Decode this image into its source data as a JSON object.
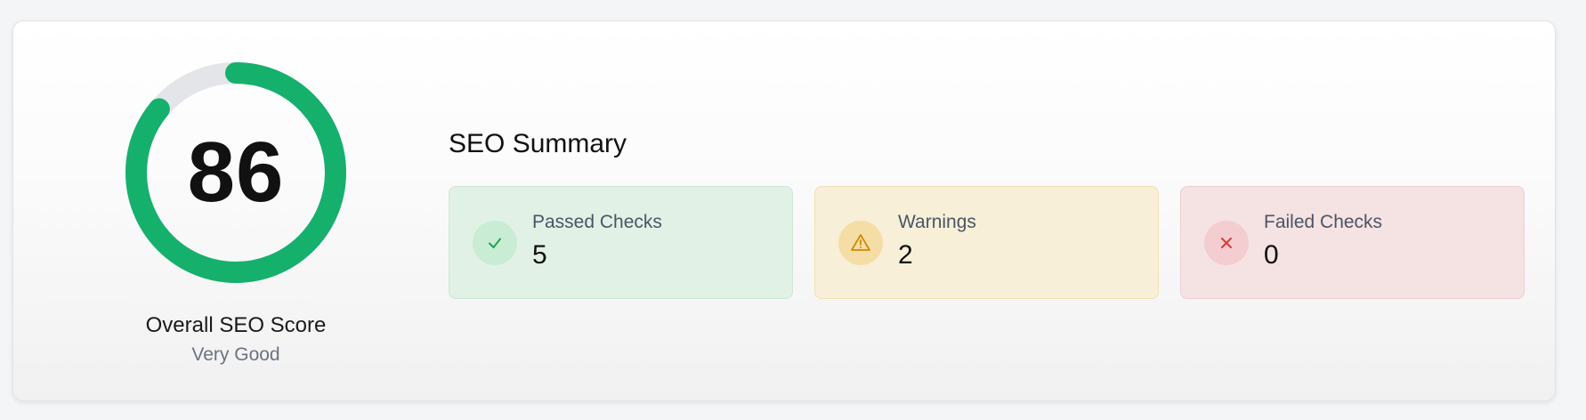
{
  "score": {
    "value": "86",
    "percent": 86,
    "label": "Overall SEO Score",
    "rating": "Very Good",
    "ring_color": "#16b06d",
    "track_color": "#e4e5e9"
  },
  "summary": {
    "title": "SEO Summary",
    "stats": [
      {
        "label": "Passed Checks",
        "value": "5",
        "icon": "check-icon",
        "color": "#22a355"
      },
      {
        "label": "Warnings",
        "value": "2",
        "icon": "warning-icon",
        "color": "#d08a06"
      },
      {
        "label": "Failed Checks",
        "value": "0",
        "icon": "x-icon",
        "color": "#d93a3a"
      }
    ]
  }
}
